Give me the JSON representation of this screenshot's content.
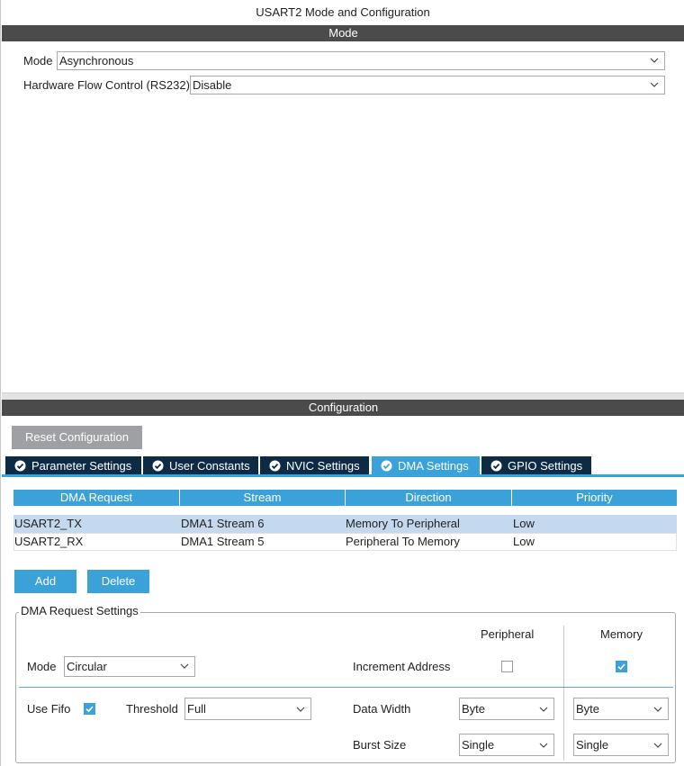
{
  "window": {
    "title": "USART2 Mode and Configuration"
  },
  "mode_section": {
    "title": "Mode",
    "mode_label": "Mode",
    "mode_value": "Asynchronous",
    "hwflow_label": "Hardware Flow Control (RS232)",
    "hwflow_value": "Disable"
  },
  "config_section": {
    "title": "Configuration",
    "reset_label": "Reset Configuration"
  },
  "tabs": [
    {
      "label": "Parameter Settings",
      "active": false,
      "icon": "check-circle-icon"
    },
    {
      "label": "User Constants",
      "active": false,
      "icon": "check-circle-icon"
    },
    {
      "label": "NVIC Settings",
      "active": false,
      "icon": "check-circle-icon"
    },
    {
      "label": "DMA Settings",
      "active": true,
      "icon": "check-circle-icon"
    },
    {
      "label": "GPIO Settings",
      "active": false,
      "icon": "check-circle-icon"
    }
  ],
  "dma_table": {
    "headers": [
      "DMA Request",
      "Stream",
      "Direction",
      "Priority"
    ],
    "rows": [
      {
        "request": "USART2_TX",
        "stream": "DMA1 Stream 6",
        "direction": "Memory To Peripheral",
        "priority": "Low",
        "selected": true
      },
      {
        "request": "USART2_RX",
        "stream": "DMA1 Stream 5",
        "direction": "Peripheral To Memory",
        "priority": "Low",
        "selected": false
      }
    ]
  },
  "actions": {
    "add_label": "Add",
    "delete_label": "Delete"
  },
  "dma_request_settings": {
    "title": "DMA Request Settings",
    "peripheral_header": "Peripheral",
    "memory_header": "Memory",
    "mode_label": "Mode",
    "mode_value": "Circular",
    "increment_label": "Increment Address",
    "increment_peripheral_checked": false,
    "increment_memory_checked": true,
    "use_fifo_label": "Use Fifo",
    "use_fifo_checked": true,
    "threshold_label": "Threshold",
    "threshold_value": "Full",
    "data_width_label": "Data Width",
    "data_width_peripheral": "Byte",
    "data_width_memory": "Byte",
    "burst_size_label": "Burst Size",
    "burst_size_peripheral": "Single",
    "burst_size_memory": "Single"
  },
  "colors": {
    "accent": "#3aa2d8",
    "tab_dark": "#0e2b45",
    "section_bar": "#4b4b4b",
    "selected_row": "#c4d9ee"
  }
}
